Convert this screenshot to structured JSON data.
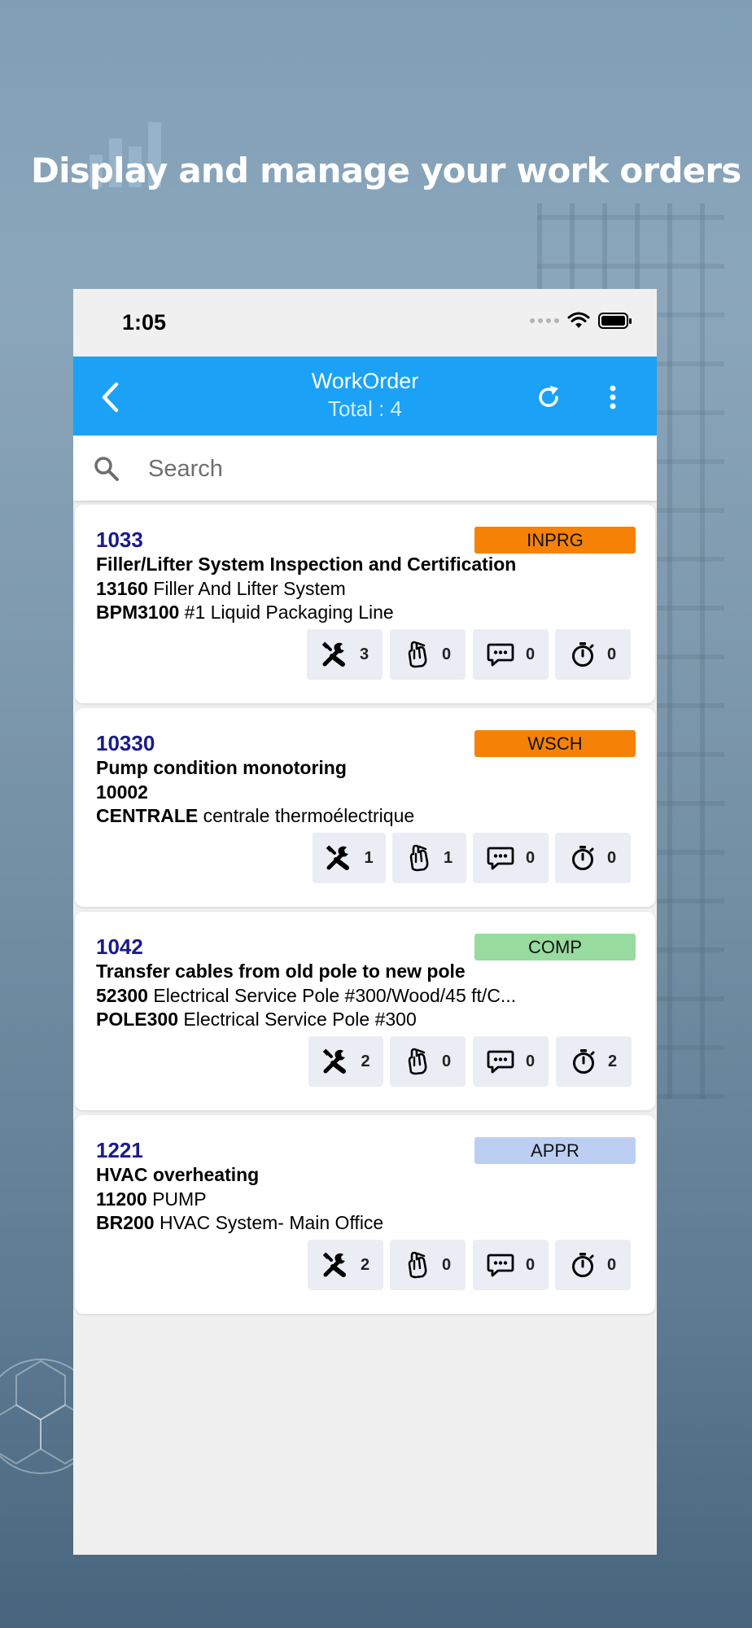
{
  "headline": "Display and manage your work orders",
  "status_bar": {
    "time": "1:05"
  },
  "app_bar": {
    "title": "WorkOrder",
    "subtitle": "Total : 4",
    "accent_color": "#1BA2F6"
  },
  "search": {
    "placeholder": "Search",
    "value": ""
  },
  "work_orders": [
    {
      "number": "1033",
      "status": "INPRG",
      "status_color": "#F58207",
      "description": "Filler/Lifter System Inspection and Certification",
      "asset_id": "13160",
      "asset_desc": "Filler And Lifter System",
      "location_id": "BPM3100",
      "location_desc": "#1 Liquid Packaging Line",
      "counts": {
        "labor": "3",
        "attachments": "0",
        "comments": "0",
        "timers": "0"
      }
    },
    {
      "number": "10330",
      "status": "WSCH",
      "status_color": "#F58207",
      "description": "Pump condition monotoring",
      "asset_id": "10002",
      "asset_desc": "",
      "location_id": "CENTRALE",
      "location_desc": "centrale thermoélectrique",
      "counts": {
        "labor": "1",
        "attachments": "1",
        "comments": "0",
        "timers": "0"
      }
    },
    {
      "number": "1042",
      "status": "COMP",
      "status_color": "#98DB9E",
      "description": "Transfer cables from old pole to new pole",
      "asset_id": "52300",
      "asset_desc": "Electrical Service Pole #300/Wood/45 ft/C...",
      "location_id": "POLE300",
      "location_desc": "Electrical Service Pole #300",
      "counts": {
        "labor": "2",
        "attachments": "0",
        "comments": "0",
        "timers": "2"
      }
    },
    {
      "number": "1221",
      "status": "APPR",
      "status_color": "#BCCFF3",
      "description": "HVAC overheating",
      "asset_id": "11200",
      "asset_desc": "PUMP",
      "location_id": "BR200",
      "location_desc": "HVAC System- Main Office",
      "counts": {
        "labor": "2",
        "attachments": "0",
        "comments": "0",
        "timers": "0"
      }
    }
  ],
  "icons": {
    "labor": "wrench-screwdriver-icon",
    "attachments": "hand-attachment-icon",
    "comments": "comment-bubble-icon",
    "timers": "stopwatch-icon"
  }
}
